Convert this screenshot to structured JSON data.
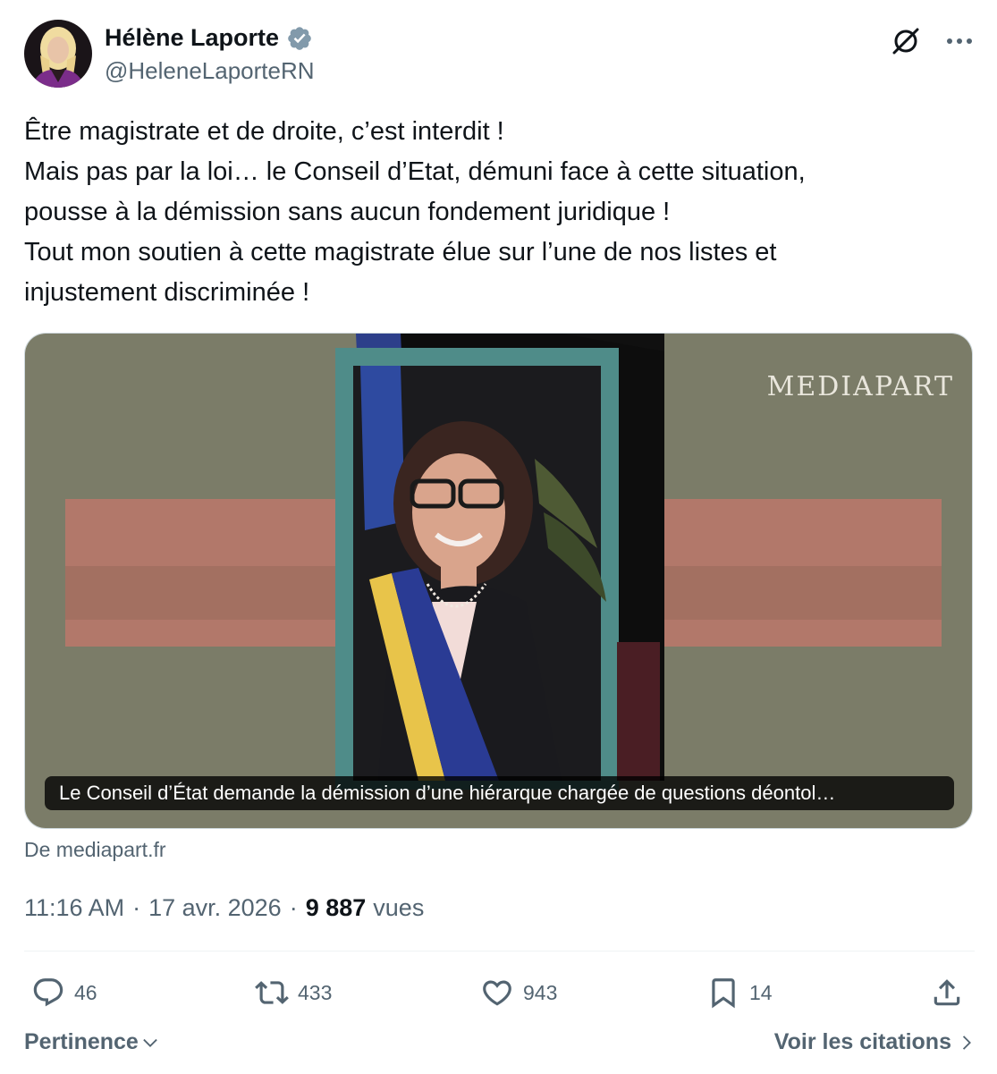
{
  "author": {
    "name": "Hélène Laporte",
    "handle": "@HeleneLaporteRN",
    "verified_color": "#829aab"
  },
  "tweet": {
    "lines": [
      "Être magistrate et de droite, c’est interdit !",
      "Mais pas par la loi… le Conseil d’Etat, démuni face à cette situation,",
      "pousse à la démission sans aucun fondement juridique !",
      "Tout mon soutien à cette magistrate élue sur l’une de nos listes et",
      "injustement discriminée !"
    ]
  },
  "card": {
    "brand": "MEDIAPART",
    "caption": "Le Conseil d’État demande la démission d’une hiérarque chargée de questions déontol…",
    "source": "De mediapart.fr"
  },
  "meta": {
    "time": "11:16 AM",
    "date": "17 avr. 2026",
    "separator": "·",
    "views_count": "9 887",
    "views_label": "vues"
  },
  "actions": {
    "replies": "46",
    "reposts": "433",
    "likes": "943",
    "bookmarks": "14"
  },
  "footer": {
    "sort_label": "Pertinence",
    "quotes_label": "Voir les citations"
  },
  "icons": {
    "grok": "grok-icon",
    "more": "more-horizontal-icon",
    "reply": "reply-icon",
    "repost": "repost-icon",
    "like": "heart-icon",
    "bookmark": "bookmark-icon",
    "share": "share-icon"
  },
  "colors": {
    "text_primary": "#0f1419",
    "text_secondary": "#536471",
    "divider": "#eff3f4",
    "card_background": "#7b7c68",
    "card_red_band": "#b8786a",
    "frame_teal": "#4f8c89"
  }
}
